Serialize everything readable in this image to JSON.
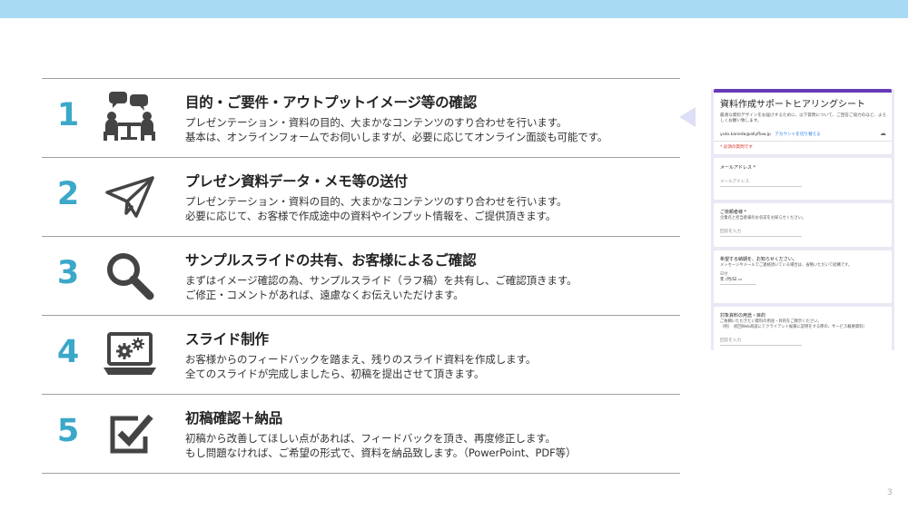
{
  "steps": [
    {
      "number": "1",
      "icon": "meeting-people-icon",
      "title": "目的・ご要件・アウトプットイメージ等の確認",
      "lines": [
        "プレゼンテーション・資料の目的、大まかなコンテンツのすり合わせを行います。",
        "基本は、オンラインフォームでお伺いしますが、必要に応じてオンライン面談も可能です。"
      ]
    },
    {
      "number": "2",
      "icon": "paper-plane-icon",
      "title": "プレゼン資料データ・メモ等の送付",
      "lines": [
        "プレゼンテーション・資料の目的、大まかなコンテンツのすり合わせを行います。",
        "必要に応じて、お客様で作成途中の資料やインプット情報を、ご提供頂きます。"
      ]
    },
    {
      "number": "3",
      "icon": "magnifier-icon",
      "title": "サンプルスライドの共有、お客様によるご確認",
      "lines": [
        "まずはイメージ確認の為、サンプルスライド（ラフ稿）を共有し、ご確認頂きます。",
        "ご修正・コメントがあれば、遠慮なくお伝えいただけます。"
      ]
    },
    {
      "number": "4",
      "icon": "laptop-gears-icon",
      "title": "スライド制作",
      "lines": [
        "お客様からのフィードバックを踏まえ、残りのスライド資料を作成します。",
        "全てのスライドが完成しましたら、初稿を提出させて頂きます。"
      ]
    },
    {
      "number": "5",
      "icon": "checkbox-icon",
      "title": "初稿確認＋納品",
      "lines": [
        "初稿から改善してほしい点があれば、フィードバックを頂き、再度修正します。",
        "もし問題なければ、ご希望の形式で、資料を納品致します。（PowerPoint、PDF等）"
      ]
    }
  ],
  "form": {
    "title": "資料作成サポートヒアリングシート",
    "description": [
      "最適な資料デザインをお届けするために、以下質問について、ご回答ご協力のほど、よろ",
      "しくお願い致します。"
    ],
    "account_email": "yuto.kaneda@allyflow.jp",
    "switch_account": "アカウントを切り替える",
    "required_note": "* 必須の質問です",
    "questions": [
      {
        "label": "メールアドレス *",
        "sub": [],
        "placeholder": "メールアドレス"
      },
      {
        "label": "ご依頼者様 *",
        "sub": [
          "企業名と担当者様のお名前をお知らせください。"
        ],
        "placeholder": "回答を入力"
      },
      {
        "label": "希望する納期を、お知らせください。",
        "sub": [
          "メッセージやメールでご連絡頂いている場合は、省略いただいて結構です。"
        ],
        "date_label": "日付",
        "date_value": "年 /月/日"
      },
      {
        "label": "対象資料の用途・目的",
        "sub": [
          "ご依頼いただきたい資料の用途・目的をご教示ください。",
          "（例）　初回Web商談にてクライアント候補に説明をする際の、サービス概要資料）"
        ],
        "placeholder": "回答を入力"
      }
    ]
  },
  "page_number": "3",
  "colors": {
    "accent": "#3ba8c9",
    "topbar": "#a9daf3",
    "form_accent": "#673ab7"
  }
}
